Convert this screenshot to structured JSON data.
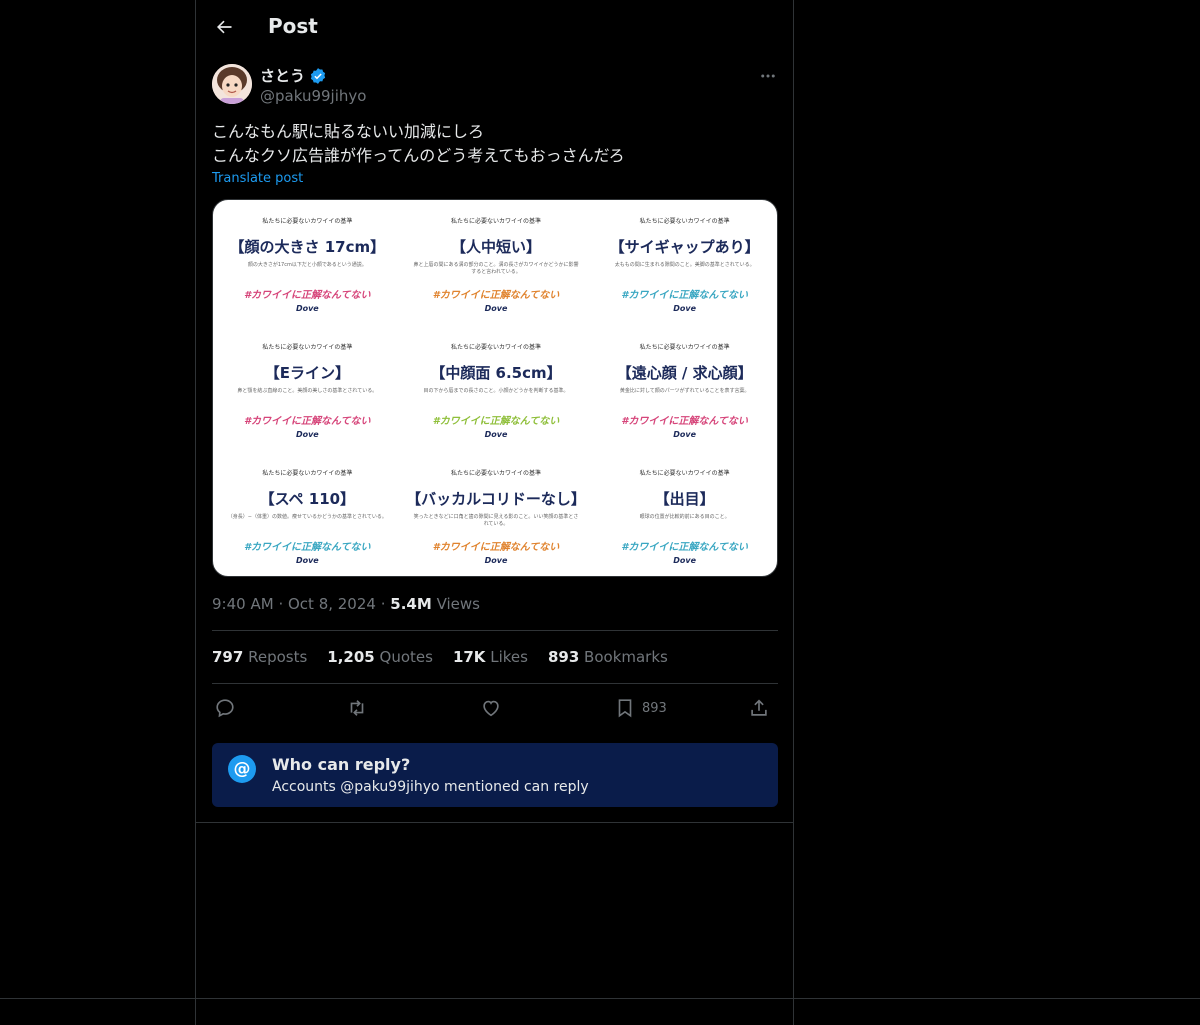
{
  "header": {
    "title": "Post"
  },
  "post": {
    "display_name": "さとう",
    "handle": "@paku99jihyo",
    "text_lines": [
      "こんなもん駅に貼るないい加減にしろ",
      "こんなクソ広告誰が作ってんのどう考えてもおっさんだろ"
    ],
    "translate_label": "Translate post",
    "time": "9:40 AM",
    "date": "Oct 8, 2024",
    "views_count": "5.4M",
    "views_label": "Views"
  },
  "media": {
    "kicker": "私たちに必要ないカワイイの基準",
    "tagline": "#カワイイに正解なんてない",
    "logo": "Dove",
    "cells": [
      {
        "headline": "【顔の大きさ 17cm】",
        "sub": "顔の大きさが17cm以下だと小顔であるという通説。",
        "tag_color": "#d6457a"
      },
      {
        "headline": "【人中短い】",
        "sub": "鼻と上唇の間にある溝の部分のこと。溝の長さがカワイイかどうかに影響すると言われている。",
        "tag_color": "#e0832e"
      },
      {
        "headline": "【サイギャップあり】",
        "sub": "太ももの間に生まれる隙間のこと。美脚の基準とされている。",
        "tag_color": "#3aa7c2"
      },
      {
        "headline": "【Eライン】",
        "sub": "鼻と顎を結ぶ直線のこと。美顔の美しさの基準とされている。",
        "tag_color": "#d6457a"
      },
      {
        "headline": "【中顔面 6.5cm】",
        "sub": "目の下から唇までの長さのこと。小顔かどうかを判断する基準。",
        "tag_color": "#8fbf3a"
      },
      {
        "headline": "【遠心顔 / 求心顔】",
        "sub": "黄金比に対して顔のパーツがずれていることを表す言葉。",
        "tag_color": "#d6457a"
      },
      {
        "headline": "【スペ 110】",
        "sub": "（身長）−（体重）の数値。痩せているかどうかの基準とされている。",
        "tag_color": "#3aa7c2"
      },
      {
        "headline": "【バッカルコリドーなし】",
        "sub": "笑ったときなどに口角と歯の隙間に見える影のこと。いい笑顔の基準とされている。",
        "tag_color": "#e0832e"
      },
      {
        "headline": "【出目】",
        "sub": "眼球の位置が比較的前にある目のこと。",
        "tag_color": "#3aa7c2"
      }
    ]
  },
  "stats": {
    "reposts_count": "797",
    "reposts_label": "Reposts",
    "quotes_count": "1,205",
    "quotes_label": "Quotes",
    "likes_count": "17K",
    "likes_label": "Likes",
    "bookmarks_count": "893",
    "bookmarks_label": "Bookmarks"
  },
  "actions": {
    "bookmark_count": "893"
  },
  "reply_restriction": {
    "icon": "@",
    "title": "Who can reply?",
    "subtitle": "Accounts @paku99jihyo mentioned can reply"
  },
  "colors": {
    "accent": "#1d9bf0",
    "verified": "#1d9bf0",
    "reply_box_bg": "#0a1c4a"
  }
}
